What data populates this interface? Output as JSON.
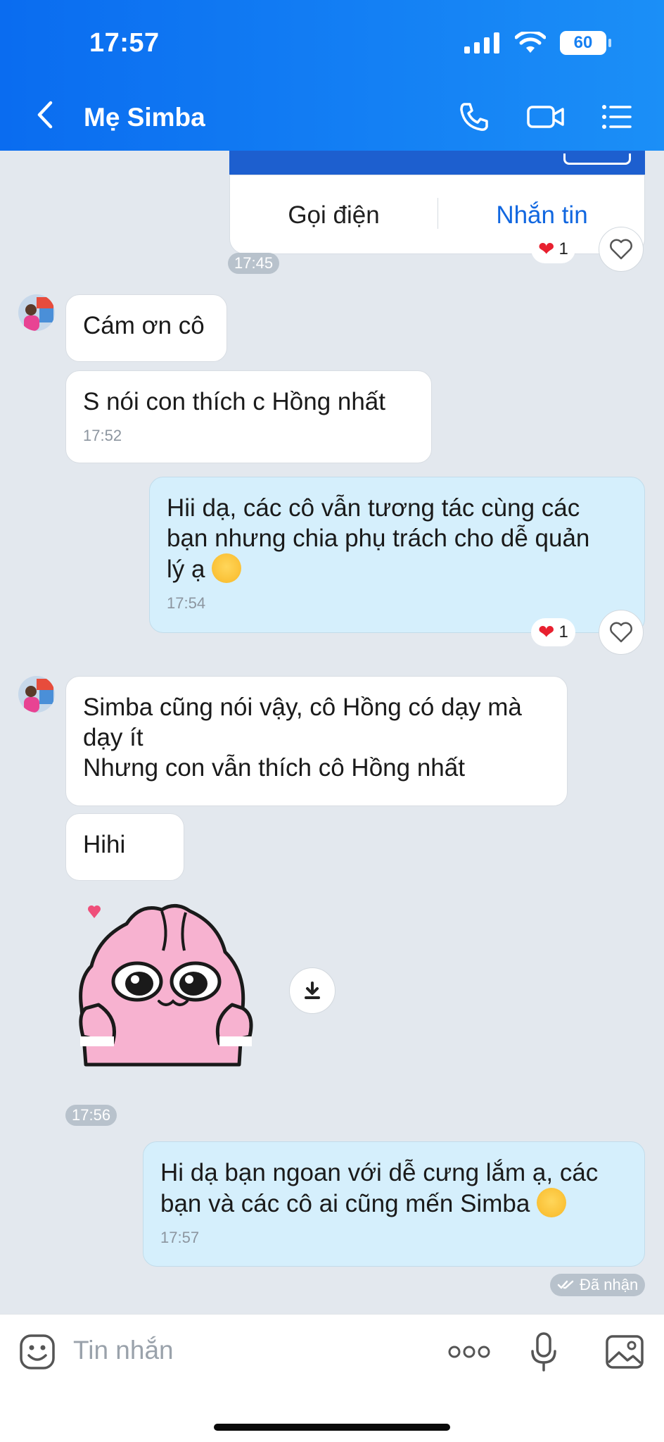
{
  "status_bar": {
    "time": "17:57",
    "battery": "60"
  },
  "header": {
    "title": "Mẹ Simba"
  },
  "contact_card": {
    "call_label": "Gọi điện",
    "message_label": "Nhắn tin"
  },
  "messages": [
    {
      "time": "17:45",
      "reaction_count": "1"
    },
    {
      "lines": [
        "Cám ơn cô"
      ]
    },
    {
      "lines": [
        "S nói con thích c Hồng nhất"
      ],
      "time": "17:52"
    },
    {
      "lines": [
        "Hii dạ, các cô vẫn tương tác cùng các",
        "bạn nhưng chia phụ trách cho dễ quản",
        "lý ạ"
      ],
      "time": "17:54",
      "reaction_count": "1"
    },
    {
      "lines": [
        "Simba cũng nói vậy, cô Hồng có dạy mà",
        "dạy ít",
        "Nhưng con vẫn thích cô Hồng nhất"
      ]
    },
    {
      "lines": [
        "Hihi"
      ]
    },
    {
      "sticker_time": "17:56"
    },
    {
      "lines": [
        "Hi dạ bạn ngoan với dễ cưng lắm ạ, các",
        "bạn và các cô ai cũng mến Simba"
      ],
      "time": "17:57",
      "status": "Đã nhận"
    }
  ],
  "input": {
    "placeholder": "Tin nhắn"
  },
  "colors": {
    "header": "#1b8ff7",
    "mine_bubble": "#d5effc",
    "link": "#1167e0",
    "heart": "#e8202f"
  },
  "icons": [
    "back-icon",
    "phone-icon",
    "video-icon",
    "menu-icon",
    "heart-icon",
    "download-icon",
    "emoji-icon",
    "more-icon",
    "mic-icon",
    "image-icon"
  ]
}
